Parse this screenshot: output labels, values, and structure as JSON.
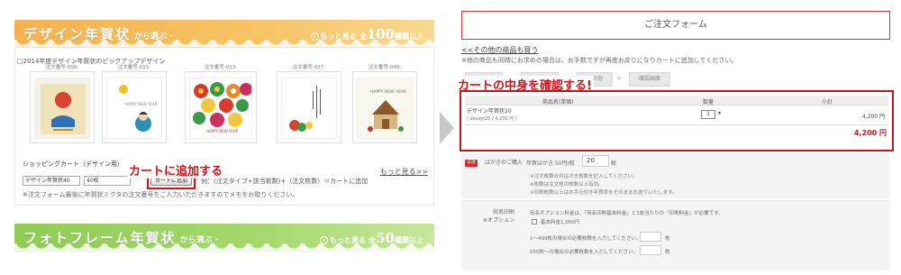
{
  "left": {
    "banner1": {
      "title": "デザイン年賀状",
      "sub": "から選ぶ・",
      "more_pre": "もっと見る",
      "count_pre": "全",
      "count": "100",
      "count_suffix": "種類以上"
    },
    "pickup_title": "□2014年度デザイン年賀状のピックアップデザイン",
    "thumbs": [
      {
        "num": "注文番号-006-"
      },
      {
        "num": "注文番号-011-"
      },
      {
        "num": "注文番号-013-"
      },
      {
        "num": "注文番号-027-"
      },
      {
        "num": "注文番号-046-"
      }
    ],
    "more_link": "もっと見る>>",
    "cart": {
      "label": "ショッピングカート（デザイン用）",
      "select_value": "デザイン年賀状40",
      "qty_value": "40枚",
      "add_button": "カートに追加",
      "formula": "例：(注文タイプ+該当枚数)+（注文枚数）＝カートに追加",
      "note": "※注文フォーム最後に年賀状ミクタの注文番号をご入力いただきますのでメモをお取りください。"
    },
    "annotation_add": "カートに追加する",
    "banner2": {
      "title": "フォトフレーム年賀状",
      "sub": "から選ぶ・",
      "more_pre": "もっと見る",
      "count_pre": "全",
      "count": "50",
      "count_suffix": "種類以上"
    }
  },
  "right": {
    "form_title": "ご注文フォーム",
    "other_link": "<<その他の商品も買う",
    "other_note": "※他の商品も同時にお求めの場合は、お手数ですが再度お戻りになりカートに追加してください。",
    "steps": [
      "その他",
      "確認画面"
    ],
    "step_sep": ">",
    "annotation_cart": "カートの中身を確認する!",
    "table": {
      "headers": {
        "product": "商品名(単価)",
        "qty": "数量",
        "subtotal": "小計"
      },
      "row": {
        "name": "デザイン年賀状20",
        "code": "( design20 / 4,200 円 )",
        "qty": "1",
        "subtotal": "4,200 円"
      },
      "total": "4,200 円"
    },
    "hagaki": {
      "required": "必須",
      "label": "はがきのご購入",
      "rate": "年賀はがき 50円/枚",
      "value": "20",
      "unit": "枚",
      "notes": [
        "※注文枚数分のはがき枚数を記入してください。",
        "※枚数は注文枚の枚数以上有効。",
        "※印刷枚数以上はお手元付き年賀状をそのままお送りいたします。"
      ]
    },
    "address": {
      "label_line1": "宛名印刷",
      "label_line2": "※オプション",
      "desc": "宛名オプション料金は、「宛名印刷基本料金」と1枚当たりの「印刷料金」が必要です。",
      "base": "基本料金1,050円",
      "row1": "1〜499枚の場合の必要枚数を入力してください。",
      "row1_unit": "枚",
      "row2": "500枚〜の場合の必要枚数を入力してください。",
      "row2_unit": "枚"
    }
  },
  "colors": {
    "highlight_red": "#d0121b",
    "orange_banner": "#f4b24f",
    "green_banner": "#8fcc53"
  }
}
